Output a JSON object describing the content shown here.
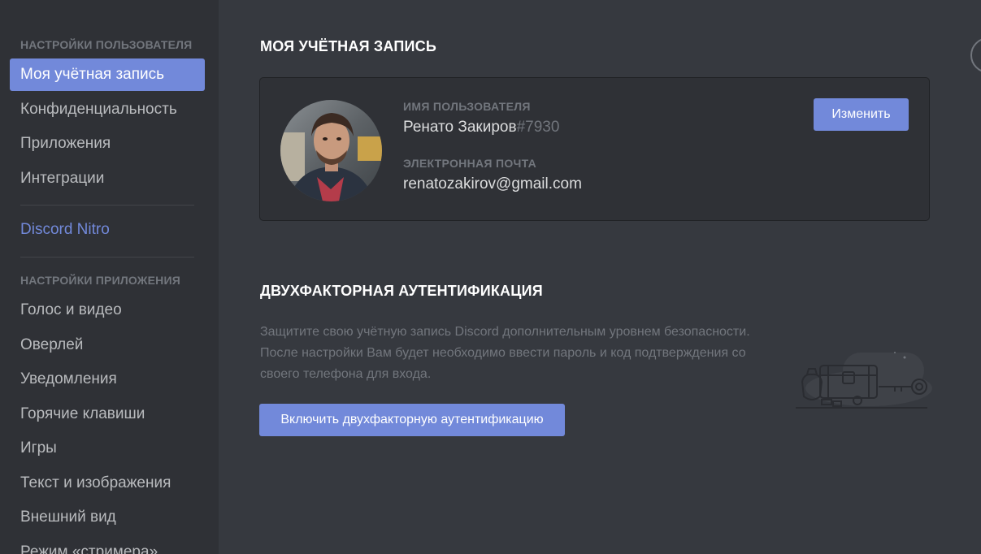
{
  "sidebar": {
    "user_settings_header": "НАСТРОЙКИ ПОЛЬЗОВАТЕЛЯ",
    "user_items": [
      {
        "label": "Моя учётная запись",
        "active": true
      },
      {
        "label": "Конфиденциальность"
      },
      {
        "label": "Приложения"
      },
      {
        "label": "Интеграции"
      }
    ],
    "nitro_label": "Discord Nitro",
    "app_settings_header": "НАСТРОЙКИ ПРИЛОЖЕНИЯ",
    "app_items": [
      {
        "label": "Голос и видео"
      },
      {
        "label": "Оверлей"
      },
      {
        "label": "Уведомления"
      },
      {
        "label": "Горячие клавиши"
      },
      {
        "label": "Игры"
      },
      {
        "label": "Текст и изображения"
      },
      {
        "label": "Внешний вид"
      },
      {
        "label": "Режим «стримера»"
      }
    ]
  },
  "account": {
    "title": "МОЯ УЧЁТНАЯ ЗАПИСЬ",
    "username_label": "ИМЯ ПОЛЬЗОВАТЕЛЯ",
    "username": "Ренато Закиров",
    "discriminator": "#7930",
    "email_label": "ЭЛЕКТРОННАЯ ПОЧТА",
    "email": "renatozakirov@gmail.com",
    "edit_button": "Изменить"
  },
  "two_factor": {
    "title": "ДВУХФАКТОРНАЯ АУТЕНТИФИКАЦИЯ",
    "description_lines": [
      "Защитите свою учётную запись Discord дополнительным уровнем безопасности.",
      "После настройки Вам будет необходимо ввести пароль и код подтверждения со",
      "своего телефона для входа."
    ],
    "enable_button": "Включить двухфакторную аутентификацию"
  },
  "colors": {
    "accent": "#7289da",
    "sidebar_bg": "#2f3136",
    "main_bg": "#36393f"
  },
  "icons": {
    "close": "close-icon",
    "illustration": "treasure-chest-key-illustration"
  }
}
